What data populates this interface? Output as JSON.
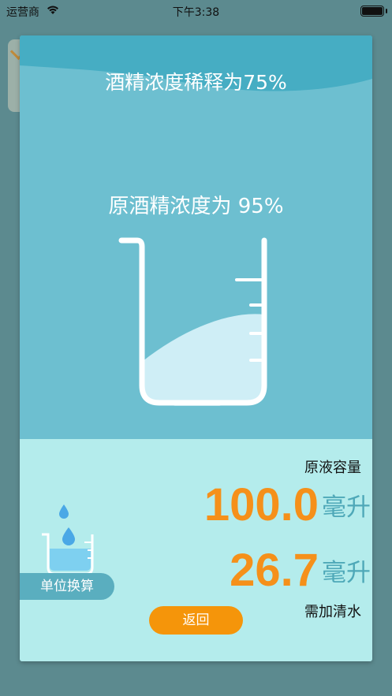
{
  "status": {
    "carrier": "运营商",
    "time": "下午3:38"
  },
  "modal": {
    "title": "酒精浓度稀释为75%",
    "original_concentration": "原酒精浓度为 95%"
  },
  "result": {
    "volume_label": "原液容量",
    "volume_value": "100.0",
    "volume_unit": "毫升",
    "water_value": "26.7",
    "water_unit": "毫升",
    "water_label": "需加清水"
  },
  "buttons": {
    "unit_convert": "单位换算",
    "back": "返回"
  },
  "colors": {
    "modal_bg": "#6dbfd0",
    "bottom_bg": "#b4ecec",
    "accent_orange": "#f5901a",
    "accent_teal": "#4ea8b8"
  },
  "icons": [
    "wifi-icon",
    "battery-icon",
    "beaker-icon",
    "water-drop-icon"
  ]
}
